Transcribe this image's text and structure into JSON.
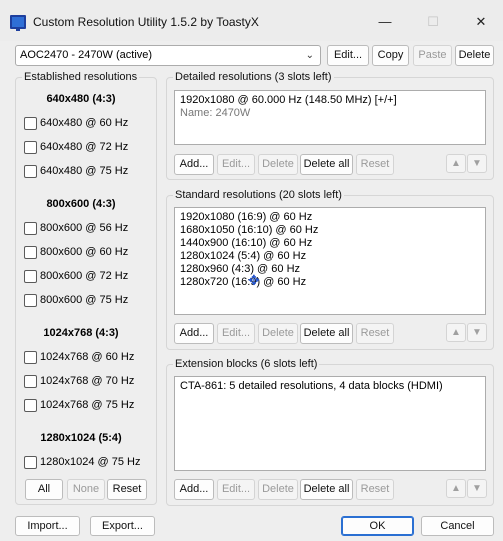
{
  "window": {
    "title": "Custom Resolution Utility 1.5.2 by ToastyX",
    "minimize": "—",
    "maximize": "☐",
    "close": "✕"
  },
  "toolbar": {
    "display_select": "AOC2470 - 2470W (active)",
    "edit": "Edit...",
    "copy": "Copy",
    "paste": "Paste",
    "delete": "Delete"
  },
  "established": {
    "label": "Established resolutions",
    "sections": [
      {
        "header": "640x480 (4:3)",
        "items": [
          "640x480 @ 60 Hz",
          "640x480 @ 72 Hz",
          "640x480 @ 75 Hz"
        ]
      },
      {
        "header": "800x600 (4:3)",
        "items": [
          "800x600 @ 56 Hz",
          "800x600 @ 60 Hz",
          "800x600 @ 72 Hz",
          "800x600 @ 75 Hz"
        ]
      },
      {
        "header": "1024x768 (4:3)",
        "items": [
          "1024x768 @ 60 Hz",
          "1024x768 @ 70 Hz",
          "1024x768 @ 75 Hz"
        ]
      },
      {
        "header": "1280x1024 (5:4)",
        "items": [
          "1280x1024 @ 75 Hz"
        ]
      }
    ],
    "all": "All",
    "none": "None",
    "reset": "Reset"
  },
  "detailed": {
    "label": "Detailed resolutions (3 slots left)",
    "line1": "1920x1080 @ 60.000 Hz (148.50 MHz) [+/+]",
    "line2": "Name: 2470W",
    "add": "Add...",
    "edit": "Edit...",
    "delete": "Delete",
    "delete_all": "Delete all",
    "reset": "Reset"
  },
  "standard": {
    "label": "Standard resolutions (20 slots left)",
    "items": [
      "1920x1080 (16:9) @ 60 Hz",
      "1680x1050 (16:10) @ 60 Hz",
      "1440x900 (16:10) @ 60 Hz",
      "1280x1024 (5:4) @ 60 Hz",
      "1280x960 (4:3) @ 60 Hz",
      "1280x720 (16:9) @ 60 Hz"
    ],
    "add": "Add...",
    "edit": "Edit...",
    "delete": "Delete",
    "delete_all": "Delete all",
    "reset": "Reset"
  },
  "extension": {
    "label": "Extension blocks (6 slots left)",
    "line1": "CTA-861: 5 detailed resolutions, 4 data blocks (HDMI)",
    "add": "Add...",
    "edit": "Edit...",
    "delete": "Delete",
    "delete_all": "Delete all",
    "reset": "Reset"
  },
  "footer": {
    "import": "Import...",
    "export": "Export...",
    "ok": "OK",
    "cancel": "Cancel"
  },
  "icons": {
    "up": "▲",
    "down": "▼",
    "chevron": "⌄"
  }
}
